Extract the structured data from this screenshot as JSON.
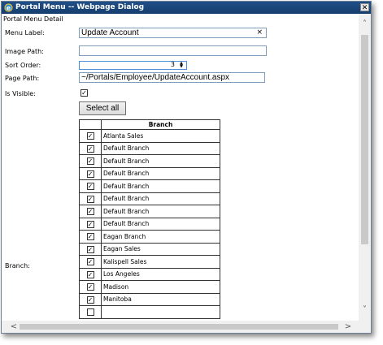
{
  "window": {
    "title": "Portal Menu -- Webpage Dialog",
    "close_label": "✕"
  },
  "form": {
    "section_title": "Portal Menu Detail",
    "menu_label": {
      "label": "Menu Label:",
      "value": "Update Account",
      "clear_label": "×"
    },
    "image_path": {
      "label": "Image Path:",
      "value": ""
    },
    "sort_order": {
      "label": "Sort Order:",
      "value": "3"
    },
    "page_path": {
      "label": "Page Path:",
      "value": "~/Portals/Employee/UpdateAccount.aspx"
    },
    "is_visible": {
      "label": "Is Visible:",
      "checked": true
    },
    "branch_label": "Branch:",
    "select_all_label": "Select all"
  },
  "branch_table": {
    "header": "Branch",
    "rows": [
      {
        "name": "Atlanta Sales",
        "checked": true
      },
      {
        "name": "Default Branch",
        "checked": true
      },
      {
        "name": "Default Branch",
        "checked": true
      },
      {
        "name": "Default Branch",
        "checked": true
      },
      {
        "name": "Default Branch",
        "checked": true
      },
      {
        "name": "Default Branch",
        "checked": true
      },
      {
        "name": "Default Branch",
        "checked": true
      },
      {
        "name": "Default Branch",
        "checked": true
      },
      {
        "name": "Eagan Branch",
        "checked": true
      },
      {
        "name": "Eagan Sales",
        "checked": true
      },
      {
        "name": "Kalispell Sales",
        "checked": true
      },
      {
        "name": "Los Angeles",
        "checked": true
      },
      {
        "name": "Madison",
        "checked": true
      },
      {
        "name": "Manitoba",
        "checked": true
      },
      {
        "name": "",
        "checked": false
      }
    ]
  },
  "colors": {
    "titlebar": "#1f4f88",
    "input_border": "#7f9db9",
    "spin_border": "#4a90d9"
  }
}
